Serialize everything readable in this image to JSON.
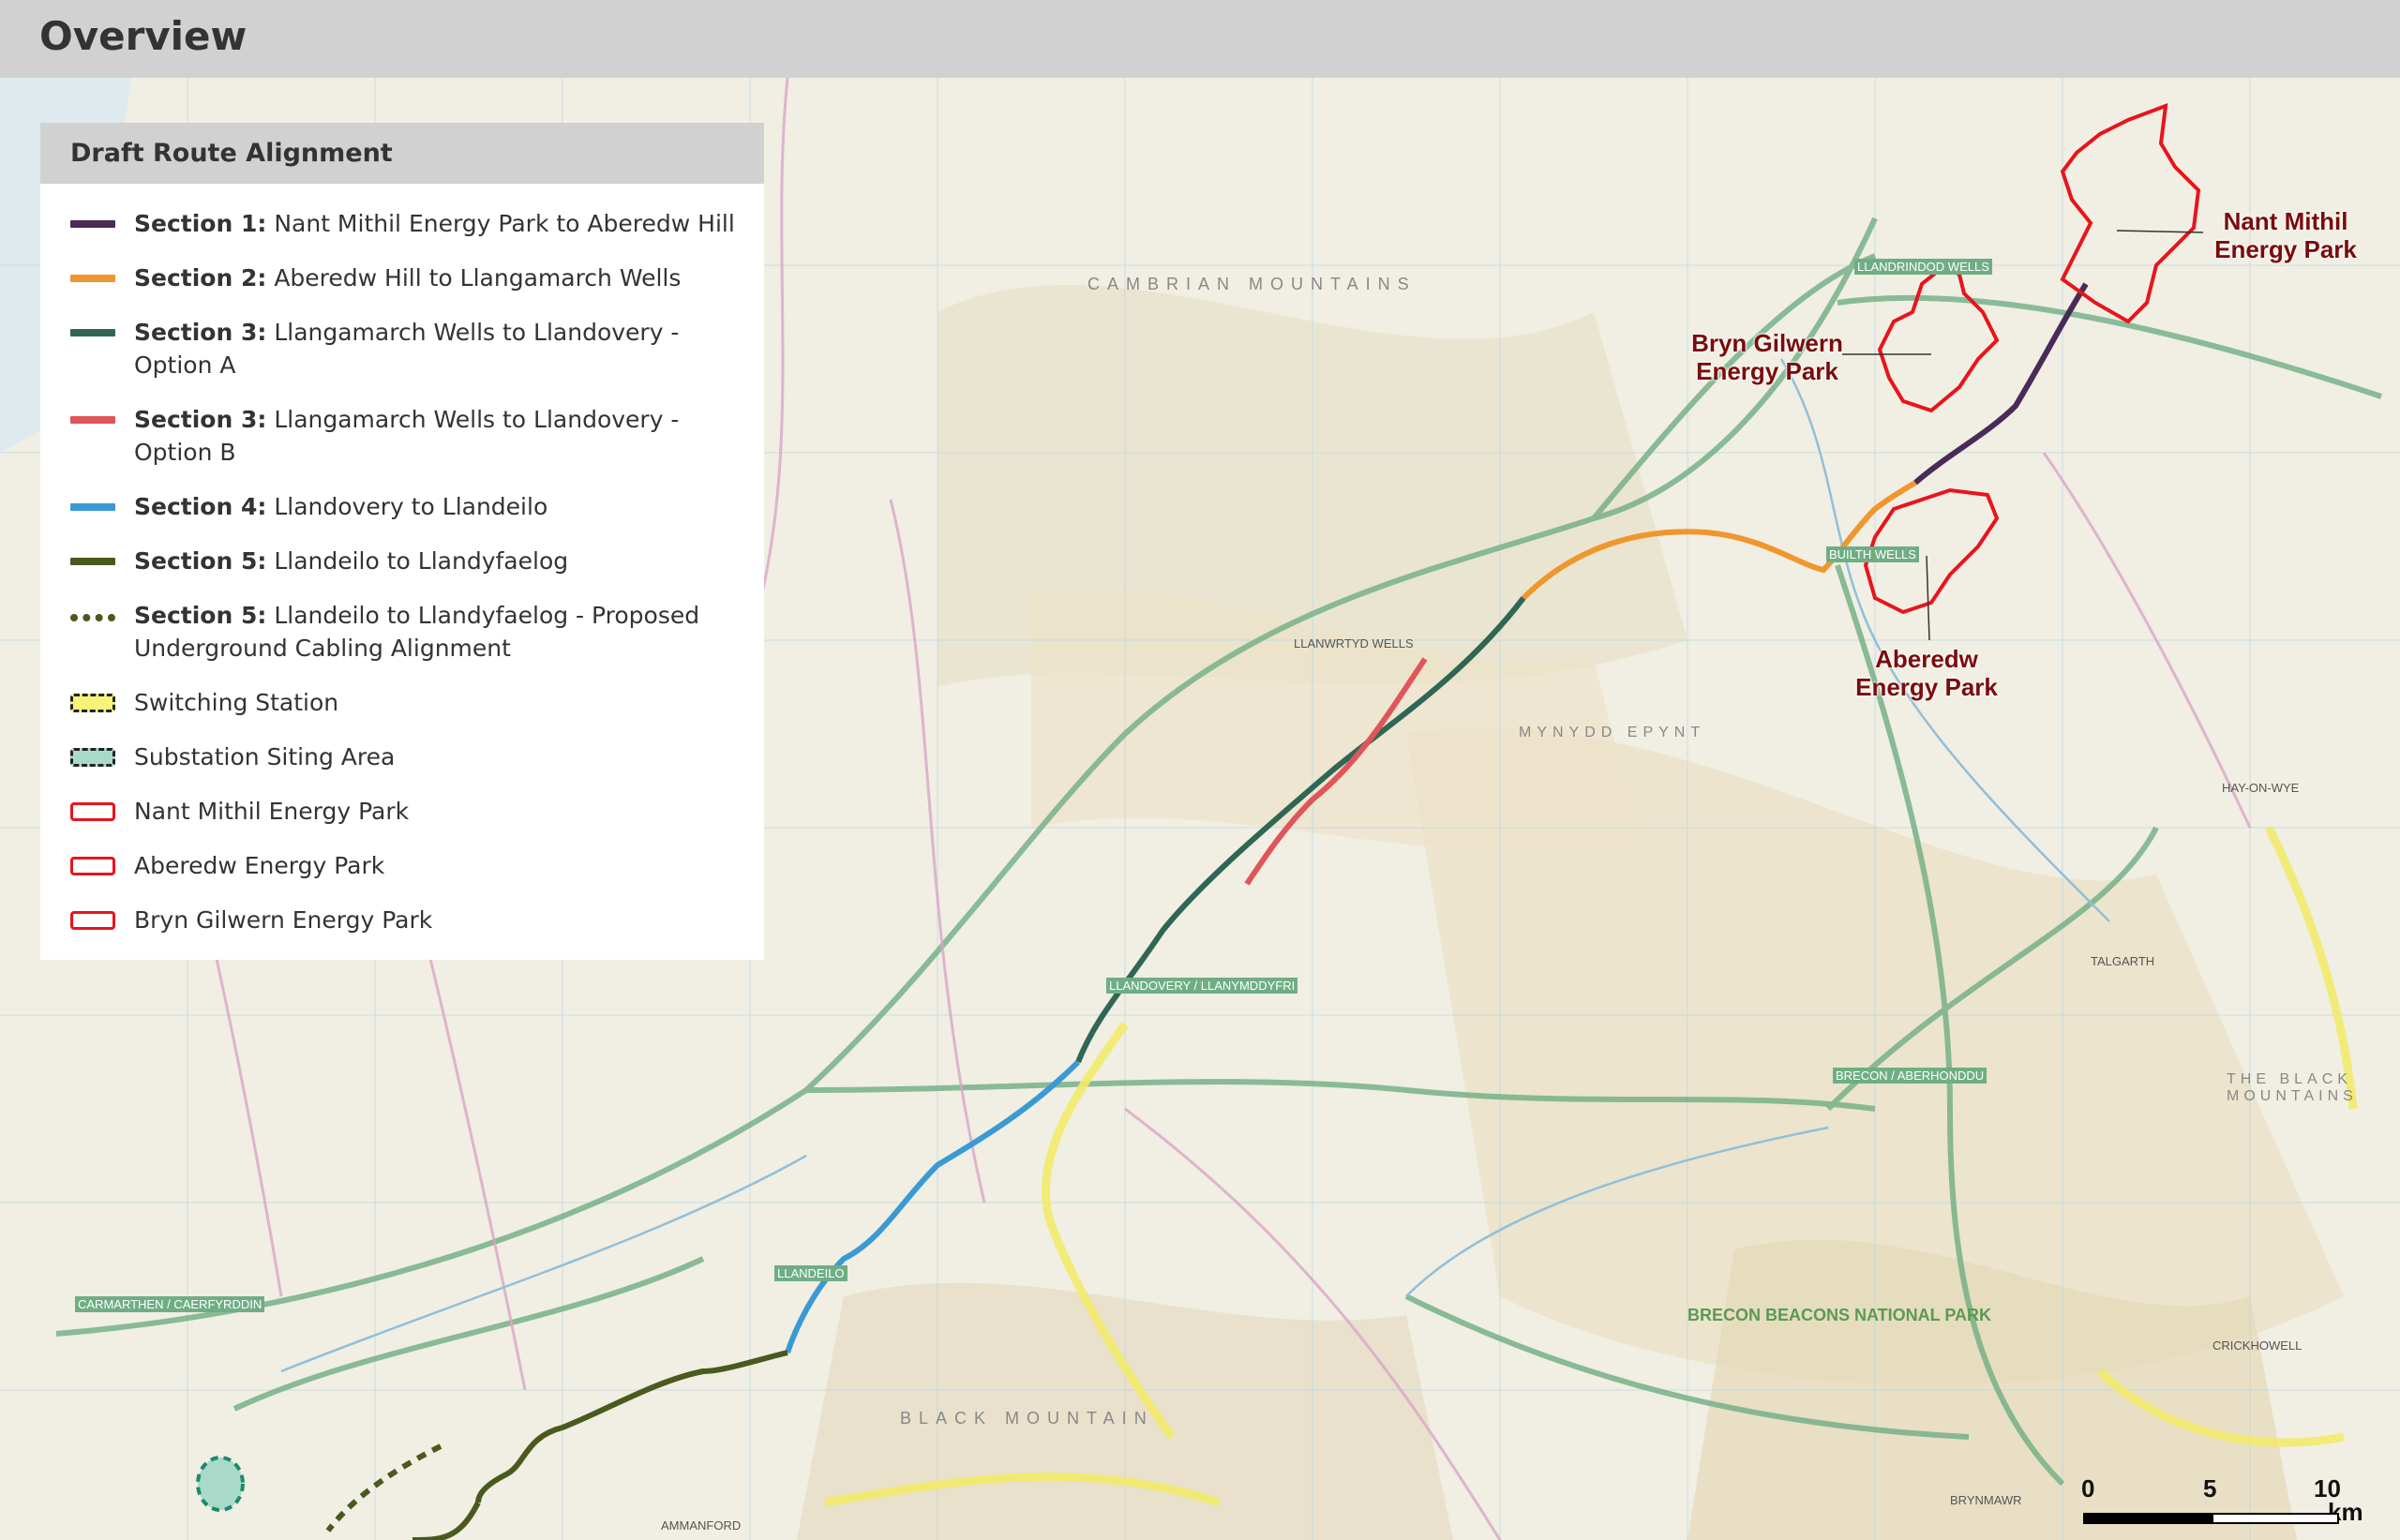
{
  "header": {
    "title": "Overview"
  },
  "legend": {
    "title": "Draft Route Alignment",
    "items": [
      {
        "bold": "Section 1:",
        "text": " Nant Mithil Energy Park to Aberedw Hill",
        "color": "#4a2a57",
        "kind": "line"
      },
      {
        "bold": "Section 2:",
        "text": " Aberedw Hill to Llangamarch Wells",
        "color": "#f0962e",
        "kind": "line"
      },
      {
        "bold": "Section 3:",
        "text": " Llangamarch Wells to Llandovery - Option A",
        "color": "#2f6655",
        "kind": "line"
      },
      {
        "bold": "Section 3:",
        "text": " Llangamarch Wells to Llandovery - Option B",
        "color": "#e0555a",
        "kind": "line"
      },
      {
        "bold": "Section 4:",
        "text": " Llandovery to Llandeilo",
        "color": "#3a9ad3",
        "kind": "line"
      },
      {
        "bold": "Section 5:",
        "text": " Llandeilo to Llandyfaelog",
        "color": "#4a5a1e",
        "kind": "line"
      },
      {
        "bold": "Section 5:",
        "text": " Llandeilo to Llandyfaelog - Proposed Underground Cabling Alignment",
        "color": "#4a5a1e",
        "kind": "dashed"
      },
      {
        "bold": "",
        "text": "Switching Station",
        "color": "#f7f37a",
        "kind": "box-dashed"
      },
      {
        "bold": "",
        "text": "Substation Siting Area",
        "color": "#a9d9c9",
        "kind": "box-dashed"
      },
      {
        "bold": "",
        "text": "Nant Mithil Energy Park",
        "color": "#e8141c",
        "kind": "box-outline"
      },
      {
        "bold": "",
        "text": "Aberedw Energy Park",
        "color": "#e8141c",
        "kind": "box-outline"
      },
      {
        "bold": "",
        "text": "Bryn Gilwern Energy Park",
        "color": "#e8141c",
        "kind": "box-outline"
      }
    ]
  },
  "map": {
    "labels": {
      "nant_mithil": "Nant Mithil\nEnergy Park",
      "bryn_gilwern": "Bryn Gilwern\nEnergy Park",
      "aberedw": "Aberedw\nEnergy Park"
    },
    "places": [
      "LLANDRINDOD WELLS",
      "LLANWRTYD WELLS",
      "BUILTH WELLS",
      "LLANDOVERY / LLANYMDDYFRI",
      "LLANDEILO",
      "CARMARTHEN / CAERFYRDDIN",
      "AMMANFORD",
      "BRECON / ABERHONDDU",
      "BRECON BEACONS NATIONAL PARK",
      "HAY-ON-WYE",
      "TALGARTH",
      "CAMBRIAN MOUNTAINS",
      "BLACK MOUNTAIN",
      "THE BLACK MOUNTAINS",
      "MYNYDD EPYNT",
      "CRICKHOWELL",
      "BRYNMAWR"
    ],
    "scale": {
      "ticks": [
        "0",
        "5",
        "10"
      ],
      "unit": "km"
    }
  }
}
